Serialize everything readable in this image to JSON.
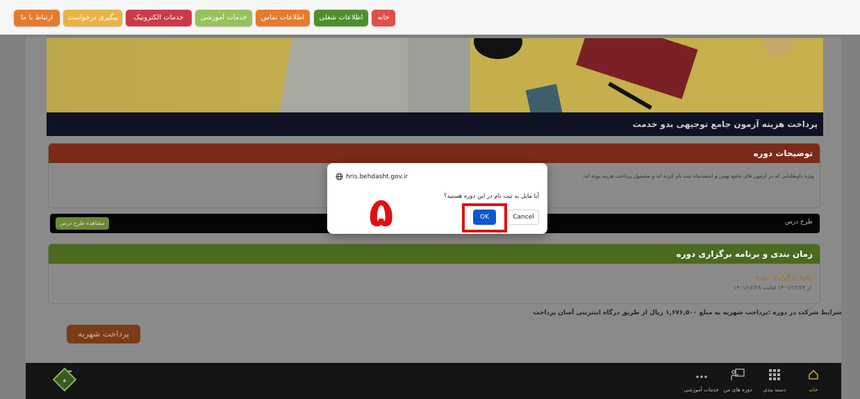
{
  "nav": [
    {
      "label": "خانه",
      "color": "#e0504a"
    },
    {
      "label": "اطلاعات شغلی",
      "color": "#4f8e2c"
    },
    {
      "label": "اطلاعات تماس",
      "color": "#e67a2e"
    },
    {
      "label": "خدمات آموزشی",
      "color": "#98c25a"
    },
    {
      "label": "خدمات الکترونیک",
      "color": "#cc3a47"
    },
    {
      "label": "پیگیری درخواست",
      "color": "#e9b345"
    },
    {
      "label": "ارتباط با ما",
      "color": "#e67a2e"
    }
  ],
  "course": {
    "title": "پرداخت هزینه آزمون جامع توجیهی بدو خدمت",
    "description_header": "توضیحات دوره",
    "description_text": "ویژه داوطلبانی که در آزمون های جامع بهمن و اسفندماه ثبت نام کرده اند و مشمول پرداخت هزینه بوده اند.",
    "plan_label": "طرح درس",
    "view_plan_button": "مشاهده طرح درس",
    "schedule_header": "زمان بندی و برنامه برگزاری دوره",
    "range_title": "بازه برگزاری دوره",
    "range_dates": "از ۱۴۰۱/۱۲/۲۴ لغایت ۱۴۰۱/۱۲/۲۸",
    "conditions": "شرایط شرکت در دوره :پرداخت شهریه به مبلغ ۱,۶۷۶,۵۰۰ ریال از طریق درگاه اینترنتی آسان پرداخت",
    "pay_button": "پرداخت شهریه"
  },
  "colors": {
    "description_header": "#7a2a18",
    "schedule_header": "#4a6a1e"
  },
  "footer": {
    "items": [
      {
        "label": "خانه",
        "icon": "home-icon"
      },
      {
        "label": "دسته بندی",
        "icon": "grid-icon"
      },
      {
        "label": "دوره های من",
        "icon": "teacher-board-icon"
      },
      {
        "label": "خدمات آموزشی",
        "icon": "more-dots-icon"
      }
    ]
  },
  "dialog": {
    "origin": "hris.behdasht.gov.ir",
    "message": "آیا مایل به ثبت نام در این دوره هستید؟",
    "ok_label": "OK",
    "cancel_label": "Cancel",
    "step_number": "۵"
  }
}
